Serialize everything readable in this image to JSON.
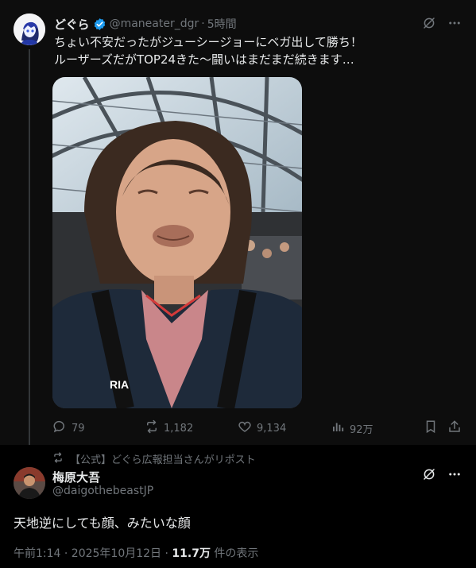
{
  "post": {
    "author_name": "どぐら",
    "handle": "@maneater_dgr",
    "separator": "·",
    "time": "5時間",
    "text_line1": "ちょい不安だったがジューシージョーにベガ出して勝ち！",
    "text_line2": "ルーザーズだがTOP24きた〜闘いはまだまだ続きます…",
    "metrics": {
      "replies": "79",
      "reposts": "1,182",
      "likes": "9,134",
      "views": "92万"
    }
  },
  "repost": {
    "label": "【公式】どぐら広報担当さんがリポスト",
    "author_name": "梅原大吾",
    "handle": "@daigothebeastJP",
    "text": "天地逆にしても顔、みたいな顔",
    "time": "午前1:14 · 2025年10月12日 · ",
    "views_count": "11.7万",
    "views_label": " 件の表示"
  },
  "colors": {
    "text_primary": "#e7e9ea",
    "text_secondary": "#71767b",
    "verified_blue": "#1d9bf0",
    "background": "#000000"
  },
  "icons": [
    "grok-icon",
    "more-icon",
    "reply-icon",
    "repost-icon",
    "like-icon",
    "views-icon",
    "bookmark-icon",
    "share-icon",
    "verified-badge-icon"
  ]
}
